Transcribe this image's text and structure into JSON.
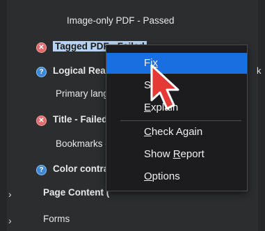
{
  "tree": {
    "image_only": "Image-only PDF - Passed",
    "tagged_pdf": "Tagged PDF - Failed",
    "logical_read": "Logical Read",
    "primary_lang": "Primary lang",
    "title_failed": "Title - Failed",
    "bookmarks": "Bookmarks -",
    "color_contrast": "Color contras",
    "page_content": "Page Content (",
    "forms": "Forms",
    "overflow_marker": "k"
  },
  "context_menu": {
    "fix_prefix": "Fi",
    "fix_suffix": "x",
    "skip_rule_a": "S",
    "skip_rule_b": "le",
    "explain_u": "E",
    "explain_rest": "xplain",
    "check_again_u": "C",
    "check_again_rest": "heck Again",
    "show_report_a": "Show ",
    "show_report_u": "R",
    "show_report_b": "eport",
    "options_u": "O",
    "options_rest": "ptions"
  },
  "colors": {
    "accent": "#1a6fe0",
    "fail": "#e26b6b",
    "help": "#3f88d6",
    "selection": "#b7d3f3",
    "cursor": "#e53935"
  }
}
